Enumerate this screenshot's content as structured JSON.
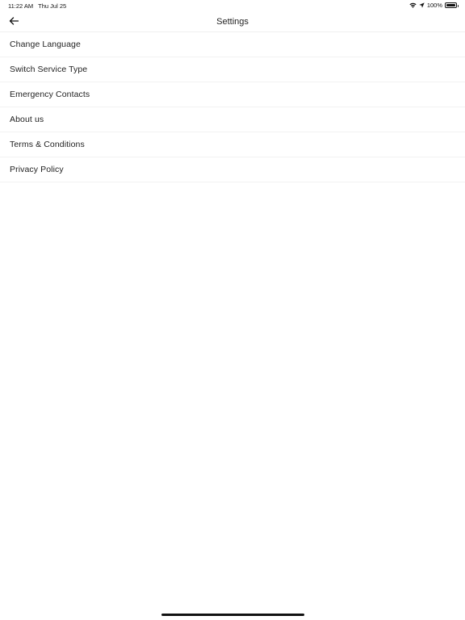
{
  "status_bar": {
    "time": "11:22 AM",
    "date": "Thu Jul 25",
    "battery": "100%",
    "icons": [
      "wifi-icon",
      "location-arrow-icon",
      "battery-icon"
    ]
  },
  "header": {
    "title": "Settings",
    "back_icon": "back-arrow-icon"
  },
  "settings": {
    "items": [
      {
        "label": "Change Language"
      },
      {
        "label": "Switch Service Type"
      },
      {
        "label": "Emergency Contacts"
      },
      {
        "label": "About us"
      },
      {
        "label": "Terms & Conditions"
      },
      {
        "label": "Privacy Policy"
      }
    ]
  }
}
